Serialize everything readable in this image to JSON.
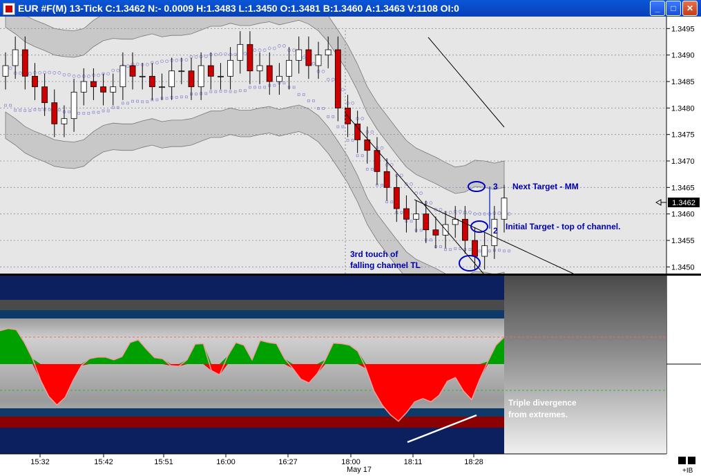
{
  "window": {
    "title": "EUR #F(M) 13-Tick C:1.3462 N:- 0.0009 H:1.3483 L:1.3450 O:1.3481 B:1.3460 A:1.3463 V:1108 OI:0",
    "minimize": "_",
    "maximize": "□",
    "close": "✕"
  },
  "chart_data": {
    "type": "candlestick",
    "instrument": "EUR #F(M)",
    "interval": "13-Tick",
    "quote": {
      "close": 1.3462,
      "change": -0.0009,
      "high": 1.3483,
      "low": 1.345,
      "open": 1.3481,
      "bid": 1.346,
      "ask": 1.3463,
      "volume": 1108,
      "open_interest": 0
    },
    "price_axis": {
      "ylim": [
        1.3449,
        1.3497
      ],
      "ticks": [
        "1.3495",
        "1.3490",
        "1.3485",
        "1.3480",
        "1.3475",
        "1.3470",
        "1.3465",
        "1.3460",
        "1.3455",
        "1.3450"
      ]
    },
    "last_price_label": "1.3462",
    "time_axis": {
      "ticks": [
        "15:32",
        "15:42",
        "15:51",
        "16:00",
        "16:27",
        "18:00",
        "18:11",
        "18:28"
      ],
      "date_label": "May 17"
    },
    "close_series": [
      1.3488,
      1.3491,
      1.3486,
      1.3484,
      1.3481,
      1.3477,
      1.3478,
      1.3483,
      1.3485,
      1.3484,
      1.3483,
      1.3484,
      1.3488,
      1.3486,
      1.3486,
      1.3484,
      1.3484,
      1.3487,
      1.3487,
      1.3484,
      1.3488,
      1.3486,
      1.3486,
      1.3489,
      1.3492,
      1.3487,
      1.3488,
      1.3485,
      1.3486,
      1.3489,
      1.3491,
      1.3488,
      1.349,
      1.3491,
      1.348,
      1.3477,
      1.3474,
      1.3472,
      1.3468,
      1.3465,
      1.3461,
      1.3459,
      1.346,
      1.3457,
      1.3456,
      1.3458,
      1.3459,
      1.3455,
      1.3452,
      1.3454,
      1.3459,
      1.3463
    ],
    "annotations": [
      {
        "text": "Next Target - MM"
      },
      {
        "text": "Initial Target - top of channel."
      },
      {
        "text": "3rd touch of"
      },
      {
        "text": "falling channel TL"
      },
      {
        "text": "Triple divergence"
      },
      {
        "text": "from extremes."
      },
      {
        "text": "3"
      },
      {
        "text": "2"
      }
    ],
    "oscillator": {
      "values": [
        62,
        66,
        64,
        40,
        10,
        -30,
        -60,
        -76,
        -62,
        -30,
        -3,
        10,
        13,
        13,
        8,
        14,
        40,
        45,
        28,
        12,
        10,
        -3,
        -4,
        8,
        37,
        38,
        -12,
        -20,
        15,
        40,
        35,
        8,
        44,
        40,
        38,
        10,
        -8,
        -28,
        -35,
        -18,
        8,
        39,
        38,
        35,
        24,
        -8,
        -50,
        -76,
        -94,
        -106,
        -90,
        -70,
        -64,
        -70,
        -58,
        -32,
        -25,
        -50,
        -66,
        -28,
        5,
        35,
        50
      ],
      "levels": [
        0
      ]
    },
    "colors": {
      "up": "#ffffff",
      "down": "#cc0000",
      "osc_pos": "#00a000",
      "osc_neg": "#ff0000",
      "annotation_blue": "#0000b0",
      "annotation_white": "#ffffff"
    }
  }
}
